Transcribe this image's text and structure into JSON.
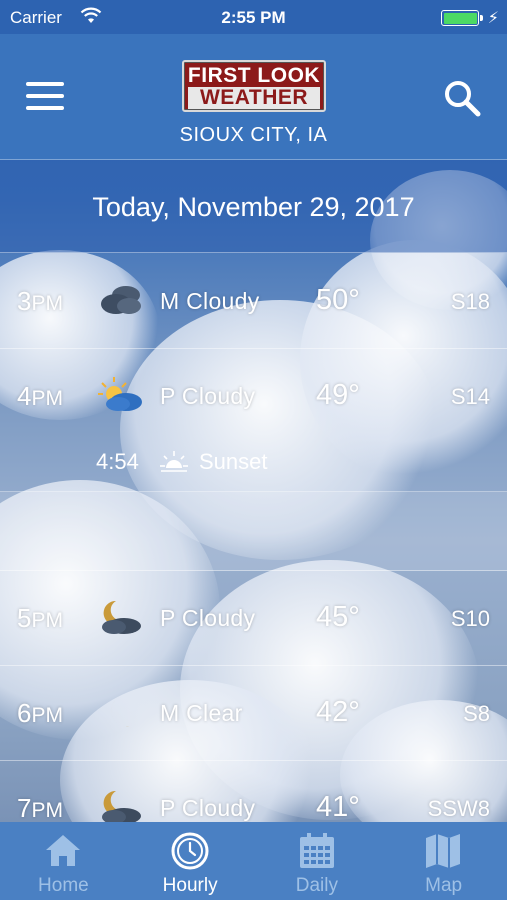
{
  "status_bar": {
    "carrier": "Carrier",
    "time": "2:55 PM"
  },
  "header": {
    "logo_line1": "FIRST LOOK",
    "logo_line2": "WEATHER",
    "location": "SIOUX CITY, IA"
  },
  "date_label": "Today, November 29, 2017",
  "hours": [
    {
      "hour": "3",
      "ampm": "PM",
      "icon": "mostly-cloudy-icon",
      "condition": "M Cloudy",
      "temp": "50°",
      "wind": "S18"
    },
    {
      "hour": "4",
      "ampm": "PM",
      "icon": "partly-cloudy-day-icon",
      "condition": "P Cloudy",
      "temp": "49°",
      "wind": "S14"
    },
    {
      "hour": "5",
      "ampm": "PM",
      "icon": "partly-cloudy-night-icon",
      "condition": "P Cloudy",
      "temp": "45°",
      "wind": "S10"
    },
    {
      "hour": "6",
      "ampm": "PM",
      "icon": "moon-icon",
      "condition": "M Clear",
      "temp": "42°",
      "wind": "S8"
    },
    {
      "hour": "7",
      "ampm": "PM",
      "icon": "partly-cloudy-night-icon",
      "condition": "P Cloudy",
      "temp": "41°",
      "wind": "SSW8"
    }
  ],
  "sunset": {
    "time": "4:54",
    "label": "Sunset"
  },
  "tabs": [
    {
      "label": "Home",
      "icon": "home-icon",
      "active": false
    },
    {
      "label": "Hourly",
      "icon": "clock-icon",
      "active": true
    },
    {
      "label": "Daily",
      "icon": "calendar-icon",
      "active": false
    },
    {
      "label": "Map",
      "icon": "map-icon",
      "active": false
    }
  ],
  "colors": {
    "header": "#3a74bd",
    "tabbar": "#4a80c3",
    "battery": "#4cd964",
    "logo_red": "#8c1a1a"
  }
}
